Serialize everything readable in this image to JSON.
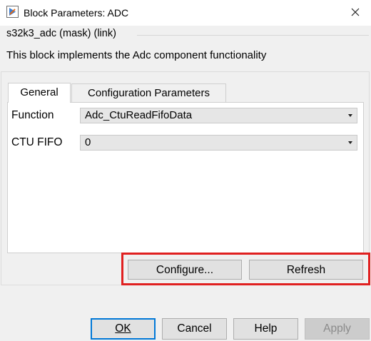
{
  "window": {
    "title": "Block Parameters: ADC",
    "app_icon": "simulink-block-icon",
    "close_icon": "close-icon"
  },
  "mask": {
    "title": "s32k3_adc (mask) (link)",
    "description": "This block implements the Adc component functionality"
  },
  "tabs": [
    {
      "label": "General",
      "active": true
    },
    {
      "label": "Configuration Parameters",
      "active": false
    }
  ],
  "fields": {
    "function": {
      "label": "Function",
      "value": "Adc_CtuReadFifoData"
    },
    "ctu_fifo": {
      "label": "CTU FIFO",
      "value": "0"
    }
  },
  "actions": {
    "configure_label": "Configure...",
    "refresh_label": "Refresh"
  },
  "dialog_buttons": {
    "ok_label": "OK",
    "cancel_label": "Cancel",
    "help_label": "Help",
    "apply_label": "Apply"
  },
  "colors": {
    "highlight": "#e02020",
    "default_button_border": "#0078d7"
  }
}
